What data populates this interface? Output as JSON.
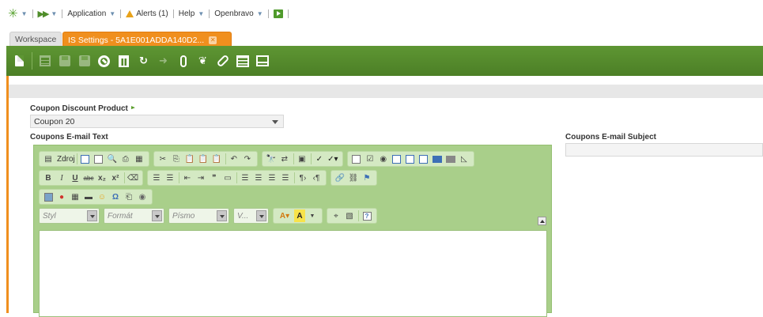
{
  "topnav": {
    "application_label": "Application",
    "alerts_label": "Alerts (1)",
    "help_label": "Help",
    "user_label": "Openbravo"
  },
  "tabs": [
    {
      "label": "Workspace"
    },
    {
      "label": "IS Settings - 5A1E001ADDA140D2..."
    }
  ],
  "form": {
    "coupon_product_label": "Coupon Discount Product",
    "coupon_product_value": "Coupon 20",
    "email_text_label": "Coupons E-mail Text",
    "email_subject_label": "Coupons E-mail Subject",
    "email_subject_value": ""
  },
  "editor": {
    "source_label": "Zdroj",
    "style_placeholder": "Styl",
    "format_placeholder": "Formát",
    "font_placeholder": "Písmo",
    "size_placeholder": "V..."
  },
  "colors": {
    "accent_orange": "#f08f1e",
    "toolbar_green": "#5e9633",
    "editor_green": "#a9cf8a"
  }
}
